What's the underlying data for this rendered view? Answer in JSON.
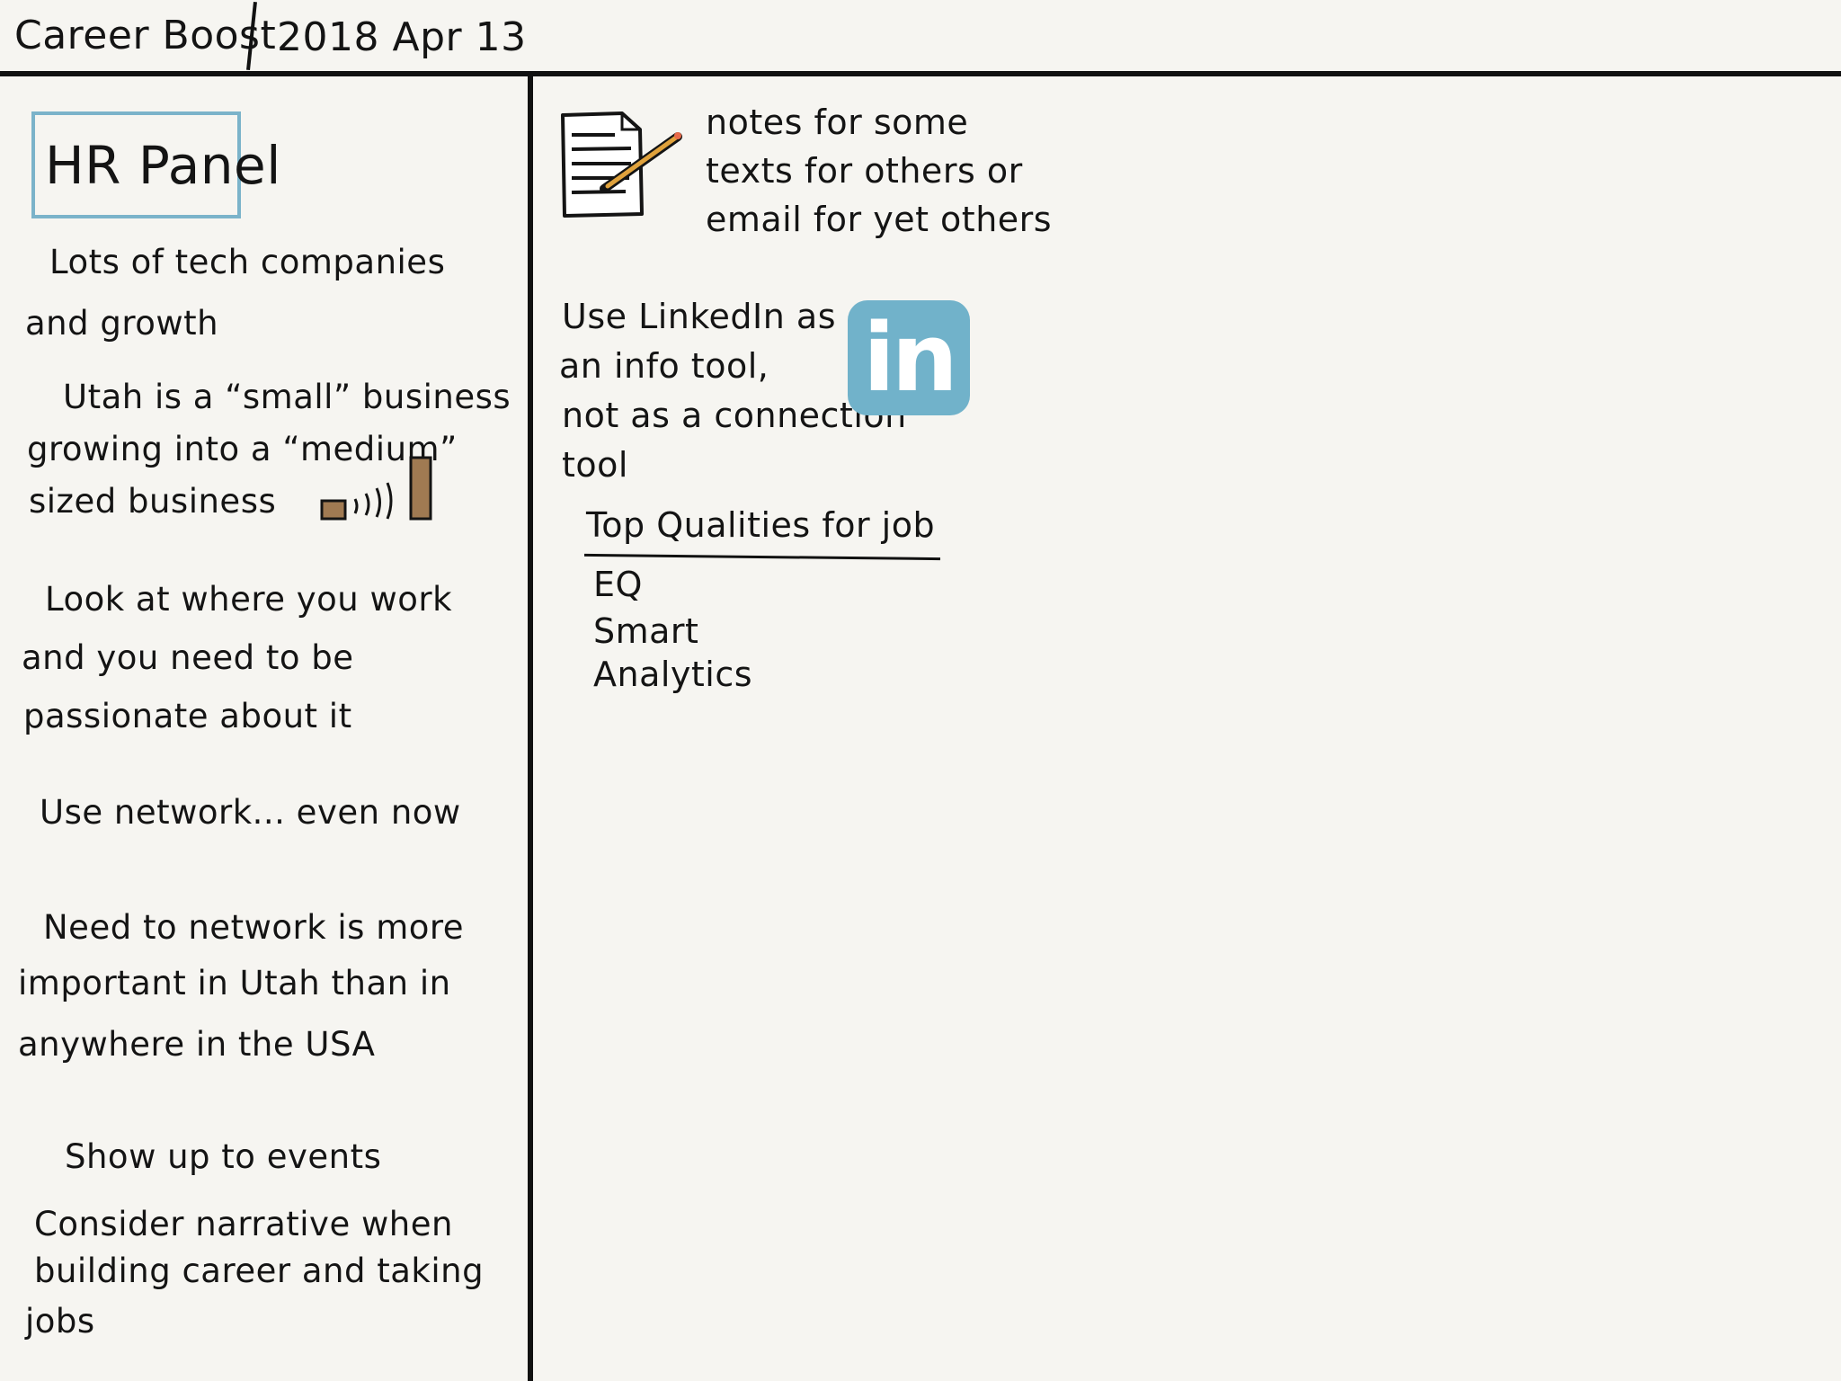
{
  "header": {
    "title": "Career Boost",
    "date": "2018  Apr  13"
  },
  "left": {
    "panel_title": "HR Panel",
    "notes": [
      "Lots of tech companies",
      "and growth",
      "Utah is a “small” business",
      "growing into a “medium”",
      "sized business",
      "Look at where you work",
      "and you need to be",
      "passionate about it",
      "Use network... even now",
      "Need to network is more",
      "important in Utah than in",
      "anywhere in the USA",
      "Show up to events",
      "Consider narrative when",
      "building career and taking",
      "jobs"
    ]
  },
  "right": {
    "notes_text": [
      "notes for some",
      "texts for others or",
      "email for yet others"
    ],
    "linkedin_text": [
      "Use LinkedIn as",
      "an info tool,",
      "not as a connection",
      "tool"
    ],
    "linkedin_badge": "in",
    "qualities": {
      "heading": "Top Qualities for job",
      "items": [
        "EQ",
        "Smart",
        "Analytics"
      ]
    }
  },
  "icons": {
    "document": "document-with-pencil-icon",
    "linkedin": "linkedin-logo-icon",
    "growth": "small-to-big-growth-icon"
  },
  "colors": {
    "background": "#f6f5f1",
    "ink": "#141414",
    "box_border": "#7bb3ca",
    "linkedin": "#71b2ca",
    "growth_block": "#a07a52",
    "pencil": "#e0a23c"
  }
}
